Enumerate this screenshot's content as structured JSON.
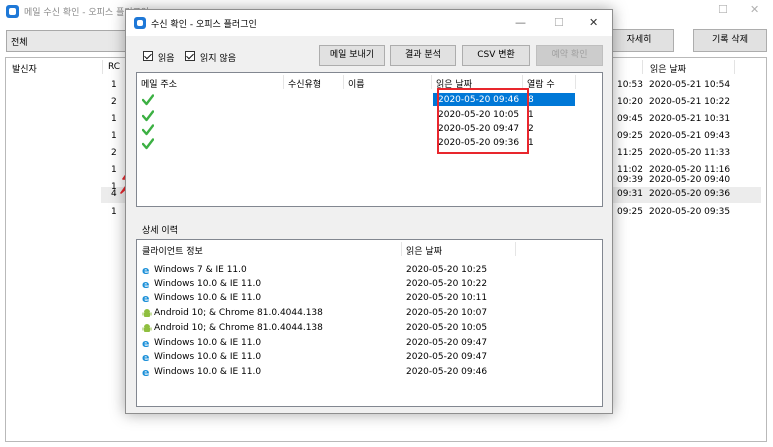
{
  "background_window": {
    "title": "메일 수신 확인 - 오피스 플러그인",
    "filter_value": "전체",
    "details_button": "자세히",
    "delete_log_button": "기록 삭제",
    "col_sender": "발신자",
    "col_rc": "RC",
    "col_read_date": "읽은 날짜",
    "rc_values": [
      "1",
      "2",
      "1",
      "1",
      "2",
      "1",
      "1",
      "4",
      "1"
    ],
    "time_col": [
      "10:53",
      "10:20",
      "09:45",
      "09:25",
      "11:25",
      "11:02",
      "09:39",
      "09:31",
      "09:25"
    ],
    "read_dates": [
      "2020-05-21 10:54",
      "2020-05-21 10:22",
      "2020-05-21 10:31",
      "2020-05-21 09:43",
      "2020-05-20 11:33",
      "2020-05-20 11:16",
      "2020-05-20 09:40",
      "2020-05-20 09:36",
      "2020-05-20 09:35"
    ]
  },
  "dialog": {
    "title": "수신 확인 - 오피스 플러그인",
    "controls": {
      "minimize": "—",
      "maximize": "☐",
      "close": "✕"
    },
    "filter_read": "읽음",
    "filter_unread": "읽지 않음",
    "buttons": {
      "send_mail": "메일 보내기",
      "analyze": "결과 분석",
      "csv": "CSV 변환",
      "schedule": "예약 확인"
    },
    "columns": {
      "address": "메일 주소",
      "recipient_type": "수신유형",
      "name": "이름",
      "read_date": "읽은 날짜",
      "open_count": "열람 수"
    },
    "rows": [
      {
        "date": "2020-05-20 09:46",
        "count": "8",
        "selected": true
      },
      {
        "date": "2020-05-20 10:05",
        "count": "1"
      },
      {
        "date": "2020-05-20 09:47",
        "count": "2"
      },
      {
        "date": "2020-05-20 09:36",
        "count": "1"
      }
    ],
    "history_label": "상세 이력",
    "history_columns": {
      "client": "클라이언트 정보",
      "read_date": "읽은 날짜"
    },
    "history": [
      {
        "icon": "ie-icon",
        "client": "Windows 7 & IE 11.0",
        "date": "2020-05-20 10:25"
      },
      {
        "icon": "ie-icon",
        "client": "Windows 10.0 & IE 11.0",
        "date": "2020-05-20 10:22"
      },
      {
        "icon": "ie-icon",
        "client": "Windows 10.0 & IE 11.0",
        "date": "2020-05-20 10:11"
      },
      {
        "icon": "android-icon",
        "client": "Android 10; & Chrome 81.0.4044.138",
        "date": "2020-05-20 10:07"
      },
      {
        "icon": "android-icon",
        "client": "Android 10; & Chrome 81.0.4044.138",
        "date": "2020-05-20 10:05"
      },
      {
        "icon": "ie-icon",
        "client": "Windows 10.0 & IE 11.0",
        "date": "2020-05-20 09:47"
      },
      {
        "icon": "ie-icon",
        "client": "Windows 10.0 & IE 11.0",
        "date": "2020-05-20 09:47"
      },
      {
        "icon": "ie-icon",
        "client": "Windows 10.0 & IE 11.0",
        "date": "2020-05-20 09:46"
      }
    ],
    "colors": {
      "selection": "#0078d7",
      "highlight_box": "#e8262d",
      "check": "#3cb043",
      "ie": "#1a8fd8",
      "android": "#8fbf3f"
    }
  }
}
